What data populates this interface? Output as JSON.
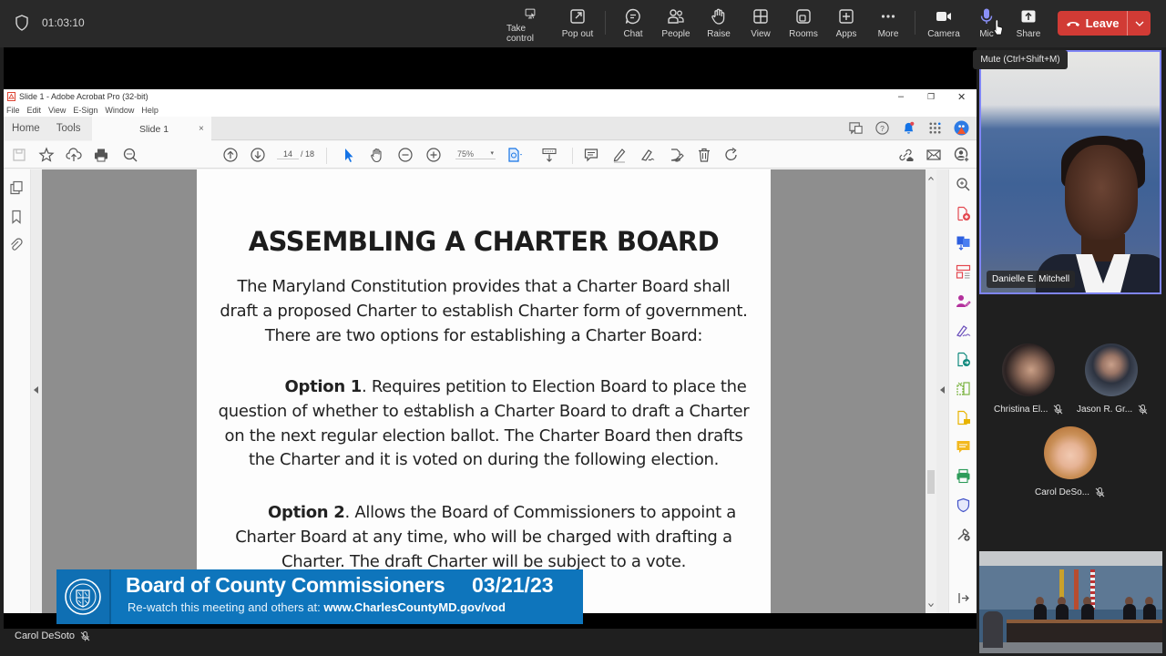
{
  "meeting": {
    "timer": "01:03:10",
    "toolbar": [
      {
        "id": "take-control",
        "label": "Take control",
        "icon": "take-control-icon"
      },
      {
        "id": "pop-out",
        "label": "Pop out",
        "icon": "pop-out-icon"
      },
      {
        "id": "chat",
        "label": "Chat",
        "icon": "chat-icon"
      },
      {
        "id": "people",
        "label": "People",
        "icon": "people-icon"
      },
      {
        "id": "raise",
        "label": "Raise",
        "icon": "raise-hand-icon"
      },
      {
        "id": "view",
        "label": "View",
        "icon": "view-grid-icon"
      },
      {
        "id": "rooms",
        "label": "Rooms",
        "icon": "rooms-icon"
      },
      {
        "id": "apps",
        "label": "Apps",
        "icon": "apps-plus-icon"
      },
      {
        "id": "more",
        "label": "More",
        "icon": "more-icon"
      },
      {
        "id": "camera",
        "label": "Camera",
        "icon": "camera-icon"
      },
      {
        "id": "mic",
        "label": "Mic",
        "icon": "mic-icon"
      },
      {
        "id": "share",
        "label": "Share",
        "icon": "share-icon"
      }
    ],
    "leave_label": "Leave",
    "mic_tooltip": "Mute (Ctrl+Shift+M)",
    "presenter_name": "Carol DeSoto",
    "colors": {
      "leave": "#d13b35",
      "accent": "#7f85f5",
      "mic_active": "#7f85f5"
    }
  },
  "participants": {
    "spotlight": {
      "name": "Danielle E. Mitchell"
    },
    "gallery": [
      {
        "name": "Christina El...",
        "muted": true
      },
      {
        "name": "Jason R. Gr...",
        "muted": true
      },
      {
        "name": "Carol DeSo...",
        "muted": true
      }
    ]
  },
  "acrobat": {
    "window_title": "Slide 1 - Adobe Acrobat Pro (32-bit)",
    "menu": [
      "File",
      "Edit",
      "View",
      "E-Sign",
      "Window",
      "Help"
    ],
    "tabs": {
      "home": "Home",
      "tools": "Tools",
      "document": "Slide 1",
      "close": "×"
    },
    "page_current": "14",
    "page_total": "/ 18",
    "zoom": "75%",
    "window_controls": {
      "minimize": "–",
      "restore": "❐",
      "close": "✕"
    }
  },
  "slide": {
    "title": "ASSEMBLING A CHARTER BOARD",
    "intro": "The Maryland Constitution provides that a Charter Board shall draft a proposed Charter to establish Charter form of government. There are two options for establishing a Charter Board:",
    "option1_label": "Option 1",
    "option1_text": ". Requires petition to Election Board to place the question of whether to establish a Charter Board to draft a Charter on the next regular election ballot. The Charter Board then drafts the Charter and it is voted on during the following election.",
    "option2_label": "Option 2",
    "option2_text": ". Allows the Board of Commissioners to appoint a Charter Board at any time, who will be charged with drafting a Charter. The draft Charter will be subject to a vote."
  },
  "banner": {
    "title": "Board of County Commissioners",
    "date": "03/21/23",
    "subtitle_prefix": "Re-watch this meeting and others at: ",
    "subtitle_url": "www.CharlesCountyMD.gov/vod",
    "color": "#0e75bc"
  }
}
